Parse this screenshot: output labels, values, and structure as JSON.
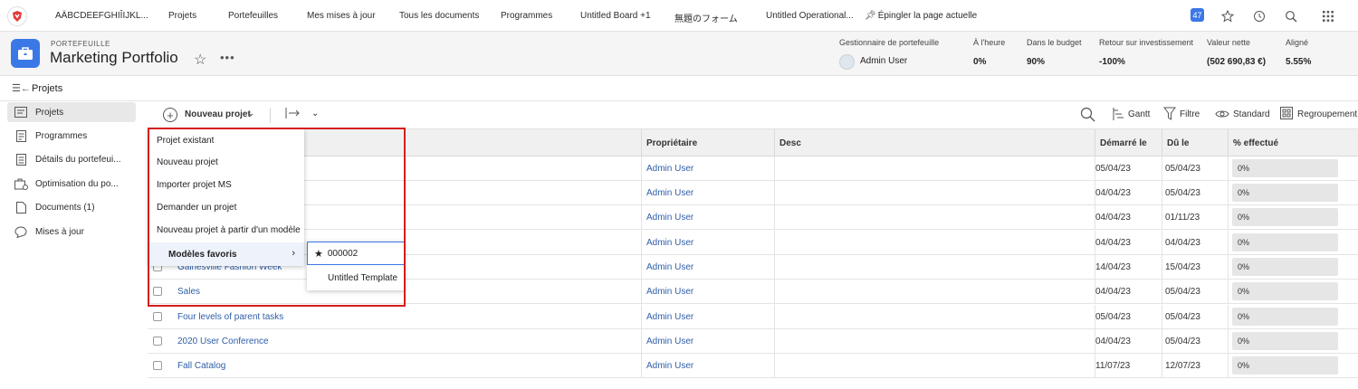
{
  "topnav": {
    "items": [
      "AÄBCDEEFGHIÎIJKL...",
      "Projets",
      "Portefeuilles",
      "Mes mises à jour",
      "Tous les documents",
      "Programmes",
      "Untitled Board +1",
      "無題のフォーム",
      "Untitled Operational..."
    ],
    "pin_label": "Épingler la page actuelle",
    "notifications_count": "47"
  },
  "header": {
    "object_type": "PORTEFEUILLE",
    "title": "Marketing Portfolio",
    "metrics": [
      {
        "label": "Gestionnaire de portefeuille",
        "value": "Admin User"
      },
      {
        "label": "À l'heure",
        "value": "0%"
      },
      {
        "label": "Dans le budget",
        "value": "90%"
      },
      {
        "label": "Retour sur investissement",
        "value": "-100%"
      },
      {
        "label": "Valeur nette",
        "value": "(502 690,83 €)"
      },
      {
        "label": "Aligné",
        "value": "5.55%"
      }
    ]
  },
  "section": {
    "title": "Projets"
  },
  "sidebar": {
    "items": [
      {
        "label": "Projets",
        "icon": "projects-icon"
      },
      {
        "label": "Programmes",
        "icon": "programs-icon"
      },
      {
        "label": "Détails du portefeui...",
        "icon": "details-icon"
      },
      {
        "label": "Optimisation du po...",
        "icon": "optimization-icon"
      },
      {
        "label": "Documents (1)",
        "icon": "documents-icon"
      },
      {
        "label": "Mises à jour",
        "icon": "updates-icon"
      }
    ]
  },
  "toolbar": {
    "new_project": "Nouveau projet",
    "gantt": "Gantt",
    "filter": "Filtre",
    "view": "Standard",
    "grouping": "Regroupement"
  },
  "table": {
    "headers": {
      "owner": "Propriétaire",
      "desc": "Desc",
      "start": "Démarré le",
      "due": "Dû le",
      "pct": "% effectué"
    },
    "rows": [
      {
        "name": "",
        "owner": "Admin User",
        "start": "05/04/23",
        "due": "05/04/23",
        "pct": "0%"
      },
      {
        "name": "",
        "owner": "Admin User",
        "start": "04/04/23",
        "due": "05/04/23",
        "pct": "0%"
      },
      {
        "name": "",
        "owner": "Admin User",
        "start": "04/04/23",
        "due": "01/11/23",
        "pct": "0%"
      },
      {
        "name": "",
        "owner": "Admin User",
        "start": "04/04/23",
        "due": "04/04/23",
        "pct": "0%"
      },
      {
        "name": "Gainesville Fashion Week",
        "owner": "Admin User",
        "start": "14/04/23",
        "due": "15/04/23",
        "pct": "0%"
      },
      {
        "name": "Sales",
        "owner": "Admin User",
        "start": "04/04/23",
        "due": "05/04/23",
        "pct": "0%"
      },
      {
        "name": "Four levels of parent tasks",
        "owner": "Admin User",
        "start": "05/04/23",
        "due": "05/04/23",
        "pct": "0%"
      },
      {
        "name": "2020 User Conference",
        "owner": "Admin User",
        "start": "04/04/23",
        "due": "05/04/23",
        "pct": "0%"
      },
      {
        "name": "Fall Catalog",
        "owner": "Admin User",
        "start": "11/07/23",
        "due": "12/07/23",
        "pct": "0%"
      }
    ]
  },
  "menu": {
    "items": [
      "Projet existant",
      "Nouveau projet",
      "Importer projet MS",
      "Demander un projet",
      "Nouveau projet à partir d'un modèle"
    ],
    "favorites": "Modèles favoris",
    "submenu": [
      "000002",
      "Untitled Template"
    ]
  }
}
